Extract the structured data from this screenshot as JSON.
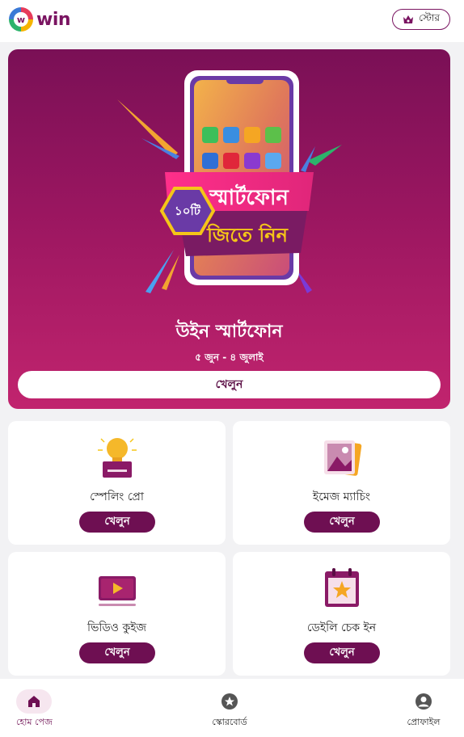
{
  "header": {
    "logo_text": "win",
    "store_label": "স্টোর"
  },
  "banner": {
    "badge_text": "১০টি",
    "headline_line1": "স্মার্টফোন",
    "headline_line2": "জিতে নিন",
    "title": "উইন স্মার্টফোন",
    "dates": "৫ জুন - ৪ জুলাই",
    "play_label": "খেলুন"
  },
  "games": [
    {
      "label": "স্পেলিং প্রো",
      "icon": "lightbulb-book-icon",
      "play_label": "খেলুন"
    },
    {
      "label": "ইমেজ ম্যাচিং",
      "icon": "image-frame-icon",
      "play_label": "খেলুন"
    },
    {
      "label": "ভিডিও কুইজ",
      "icon": "video-play-icon",
      "play_label": "খেলুন"
    },
    {
      "label": "ডেইলি চেক ইন",
      "icon": "calendar-star-icon",
      "play_label": "খেলুন"
    }
  ],
  "bottom_nav": [
    {
      "label": "হোম পেজ",
      "icon": "home-icon",
      "active": true
    },
    {
      "label": "স্কোরবোর্ড",
      "icon": "scoreboard-icon",
      "active": false
    },
    {
      "label": "প্রোফাইল",
      "icon": "profile-icon",
      "active": false
    }
  ],
  "colors": {
    "brand": "#6e0f52",
    "banner_top": "#7a1056",
    "banner_bottom": "#c1246e",
    "accent_pink": "#e0267a",
    "accent_yellow": "#f5c518"
  }
}
